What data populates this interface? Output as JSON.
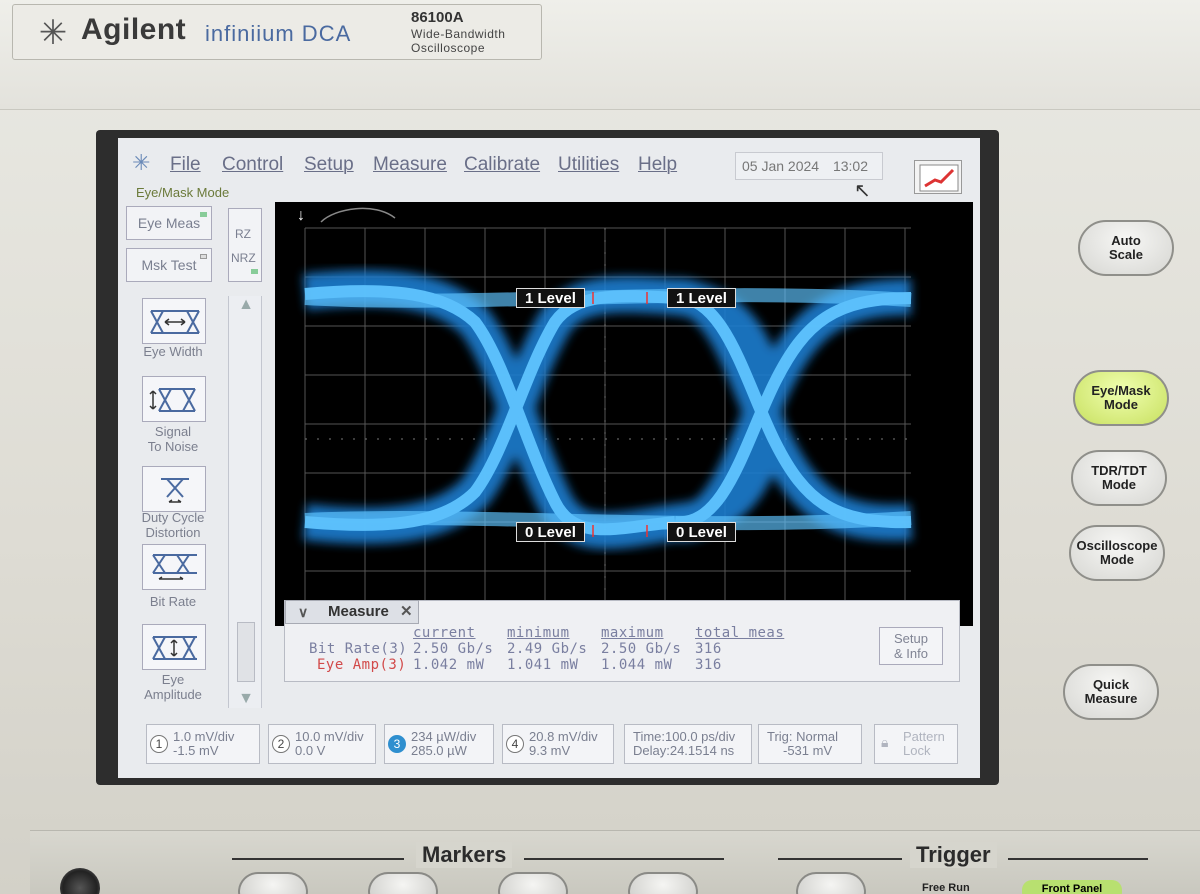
{
  "instrument": {
    "brand": "Agilent",
    "product": "infiniium DCA",
    "model": "86100A",
    "description": "Wide-Bandwidth\nOscilloscope"
  },
  "menu": {
    "items": [
      "File",
      "Control",
      "Setup",
      "Measure",
      "Calibrate",
      "Utilities",
      "Help"
    ],
    "date": "05 Jan 2024",
    "time": "13:02"
  },
  "mode_label": "Eye/Mask Mode",
  "left_panel": {
    "eye_meas": "Eye Meas",
    "mask_test": "Msk Test",
    "rz": "RZ",
    "nrz": "NRZ",
    "measurements": [
      {
        "label": "Eye Width"
      },
      {
        "label": "Signal\nTo Noise"
      },
      {
        "label": "Duty Cycle\nDistortion"
      },
      {
        "label": "Bit Rate"
      },
      {
        "label": "Eye\nAmplitude"
      }
    ]
  },
  "scope": {
    "level_tags": {
      "one_left": "1 Level",
      "one_right": "1 Level",
      "zero_left": "0 Level",
      "zero_right": "0 Level"
    },
    "trace_color": "#35a8f0",
    "grid_color": "#5a5a5a"
  },
  "measure_panel": {
    "tab": "Measure",
    "columns": [
      "current",
      "minimum",
      "maximum",
      "total meas"
    ],
    "rows": [
      {
        "name": "Bit Rate(3)",
        "current": "2.50 Gb/s",
        "minimum": "2.49 Gb/s",
        "maximum": "2.50 Gb/s",
        "total": "316"
      },
      {
        "name": "Eye Amp(3)",
        "current": "1.042 mW",
        "minimum": "1.041 mW",
        "maximum": "1.044 mW",
        "total": "316"
      }
    ],
    "setup_btn": "Setup\n& Info"
  },
  "channels": [
    {
      "num": "1",
      "text": "1.0 mV/div\n-1.5 mV",
      "active": false
    },
    {
      "num": "2",
      "text": "10.0 mV/div\n0.0 V",
      "active": false
    },
    {
      "num": "3",
      "text": "234 µW/div\n285.0 µW",
      "active": true
    },
    {
      "num": "4",
      "text": "20.8 mV/div\n9.3 mV",
      "active": false
    }
  ],
  "timebase": {
    "time": "Time:100.0 ps/div",
    "delay": "Delay:24.1514 ns"
  },
  "trigger_info": {
    "trig": "Trig: Normal",
    "level": "-531 mV"
  },
  "pattern_lock": "Pattern\nLock",
  "hardware_buttons": {
    "auto_scale": "Auto\nScale",
    "eye_mask_mode": "Eye/Mask\nMode",
    "tdr_mode": "TDR/TDT\nMode",
    "scope_mode": "Oscilloscope\nMode",
    "quick_measure": "Quick\nMeasure"
  },
  "bottom": {
    "markers": "Markers",
    "trigger": "Trigger",
    "free_run": "Free Run",
    "front_panel": "Front Panel"
  }
}
